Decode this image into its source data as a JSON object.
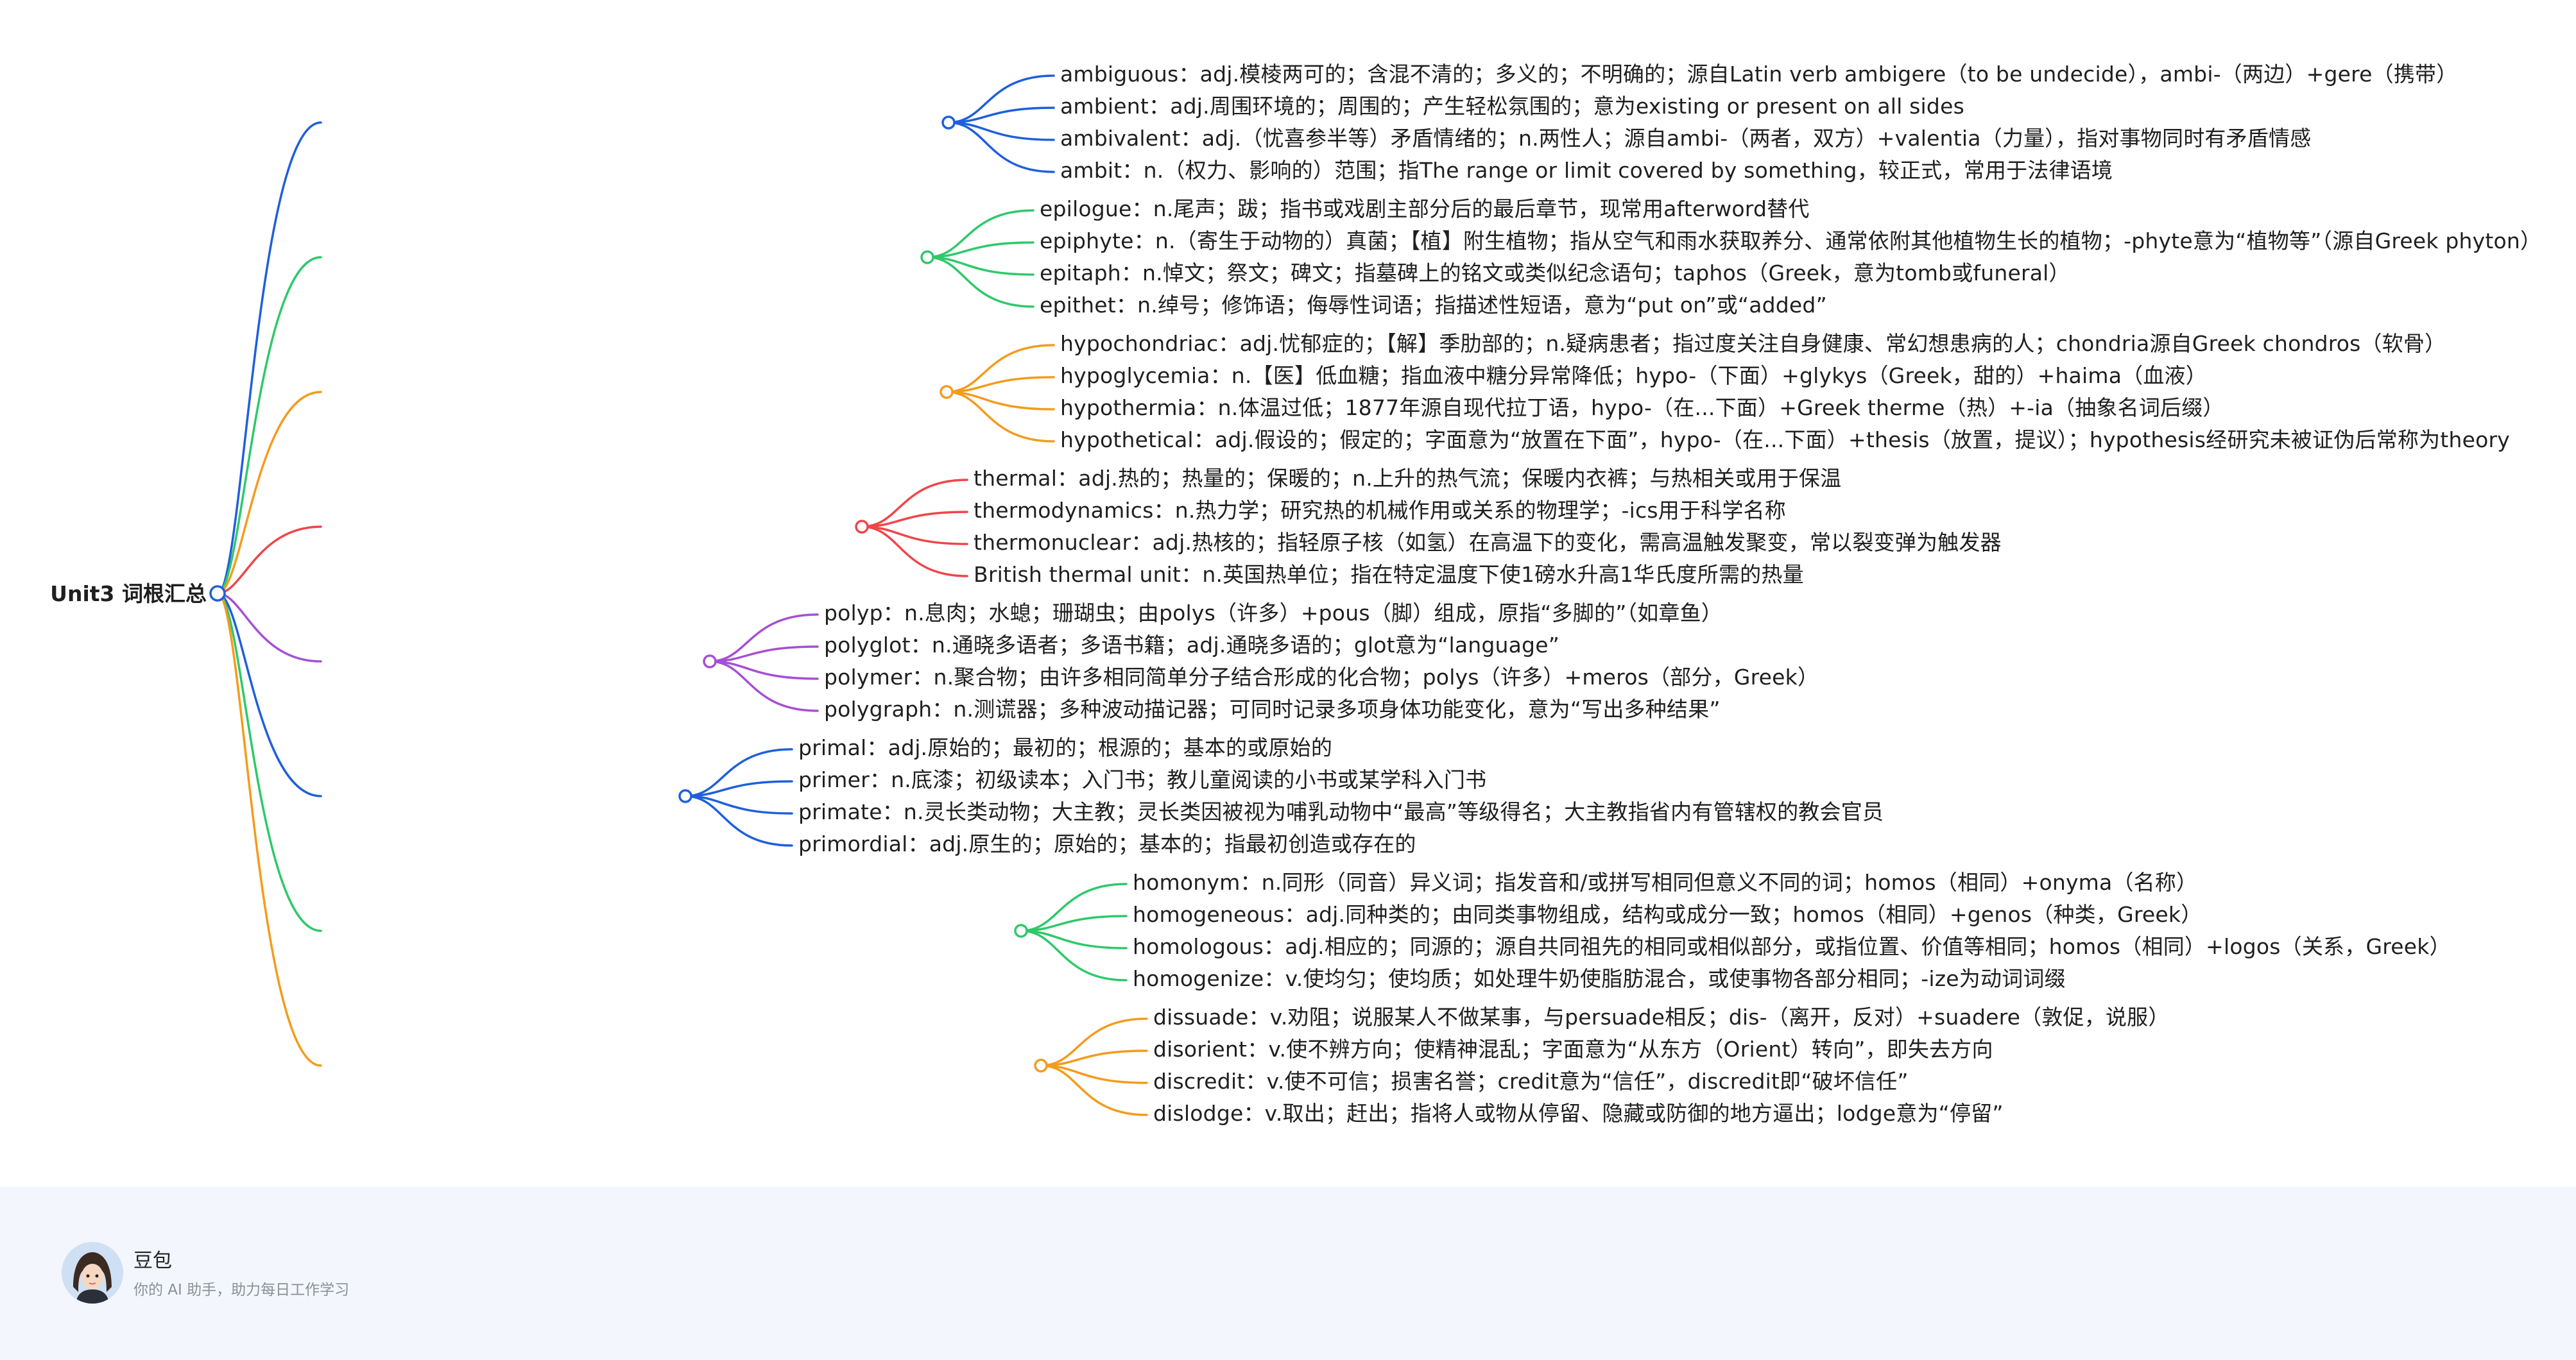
{
  "mindmap": {
    "root": "Unit3 词根汇总",
    "branches": [
      {
        "color": "#1f5fdc",
        "items": [
          "ambiguous：adj.模棱两可的；含混不清的；多义的；不明确的；源自Latin verb ambigere（to be undecide），ambi-（两边）+gere（携带）",
          "ambient：adj.周围环境的；周围的；产生轻松氛围的；意为existing or present on all sides",
          "ambivalent：adj.（忧喜参半等）矛盾情绪的；n.两性人；源自ambi-（两者，双方）+valentia（力量），指对事物同时有矛盾情感",
          "ambit：n.（权力、影响的）范围；指The range or limit covered by something，较正式，常用于法律语境"
        ]
      },
      {
        "color": "#2ec96a",
        "items": [
          "epilogue：n.尾声；跋；指书或戏剧主部分后的最后章节，现常用afterword替代",
          "epiphyte：n.（寄生于动物的）真菌；【植】附生植物；指从空气和雨水获取养分、通常依附其他植物生长的植物；-phyte意为“植物等”（源自Greek phyton）",
          "epitaph：n.悼文；祭文；碑文；指墓碑上的铭文或类似纪念语句；taphos（Greek，意为tomb或funeral）",
          "epithet：n.绰号；修饰语；侮辱性词语；指描述性短语，意为“put on”或“added”"
        ]
      },
      {
        "color": "#f59b1c",
        "items": [
          "hypochondriac：adj.忧郁症的；【解】季肋部的；n.疑病患者；指过度关注自身健康、常幻想患病的人；chondria源自Greek chondros（软骨）",
          "hypoglycemia：n.【医】低血糖；指血液中糖分异常降低；hypo-（下面）+glykys（Greek，甜的）+haima（血液）",
          "hypothermia：n.体温过低；1877年源自现代拉丁语，hypo-（在...下面）+Greek therme（热）+-ia（抽象名词后缀）",
          "hypothetical：adj.假设的；假定的；字面意为“放置在下面”，hypo-（在...下面）+thesis（放置，提议）；hypothesis经研究未被证伪后常称为theory"
        ]
      },
      {
        "color": "#f0454a",
        "items": [
          "thermal：adj.热的；热量的；保暖的；n.上升的热气流；保暖内衣裤；与热相关或用于保温",
          "thermodynamics：n.热力学；研究热的机械作用或关系的物理学；-ics用于科学名称",
          "thermonuclear：adj.热核的；指轻原子核（如氢）在高温下的变化，需高温触发聚变，常以裂变弹为触发器",
          "British thermal unit：n.英国热单位；指在特定温度下使1磅水升高1华氏度所需的热量"
        ]
      },
      {
        "color": "#a64fd6",
        "items": [
          "polyp：n.息肉；水螅；珊瑚虫；由polys（许多）+pous（脚）组成，原指“多脚的”（如章鱼）",
          "polyglot：n.通晓多语者；多语书籍；adj.通晓多语的；glot意为“language”",
          "polymer：n.聚合物；由许多相同简单分子结合形成的化合物；polys（许多）+meros（部分，Greek）",
          "polygraph：n.测谎器；多种波动描记器；可同时记录多项身体功能变化，意为“写出多种结果”"
        ]
      },
      {
        "color": "#1f5fdc",
        "items": [
          "primal：adj.原始的；最初的；根源的；基本的或原始的",
          "primer：n.底漆；初级读本；入门书；教儿童阅读的小书或某学科入门书",
          "primate：n.灵长类动物；大主教；灵长类因被视为哺乳动物中“最高”等级得名；大主教指省内有管辖权的教会官员",
          "primordial：adj.原生的；原始的；基本的；指最初创造或存在的"
        ]
      },
      {
        "color": "#2ec96a",
        "items": [
          "homonym：n.同形（同音）异义词；指发音和/或拼写相同但意义不同的词；homos（相同）+onyma（名称）",
          "homogeneous：adj.同种类的；由同类事物组成，结构或成分一致；homos（相同）+genos（种类，Greek）",
          "homologous：adj.相应的；同源的；源自共同祖先的相同或相似部分，或指位置、价值等相同；homos（相同）+logos（关系，Greek）",
          "homogenize：v.使均匀；使均质；如处理牛奶使脂肪混合，或使事物各部分相同；-ize为动词词缀"
        ]
      },
      {
        "color": "#f59b1c",
        "items": [
          "dissuade：v.劝阻；说服某人不做某事，与persuade相反；dis-（离开，反对）+suadere（敦促，说服）",
          "disorient：v.使不辨方向；使精神混乱；字面意为“从东方（Orient）转向”，即失去方向",
          "discredit：v.使不可信；损害名誉；credit意为“信任”，discredit即“破坏信任”",
          "dislodge：v.取出；赶出；指将人或物从停留、隐藏或防御的地方逼出；lodge意为“停留”"
        ]
      }
    ]
  },
  "footer": {
    "name": "豆包",
    "tagline": "你的 AI 助手，助力每日工作学习"
  }
}
